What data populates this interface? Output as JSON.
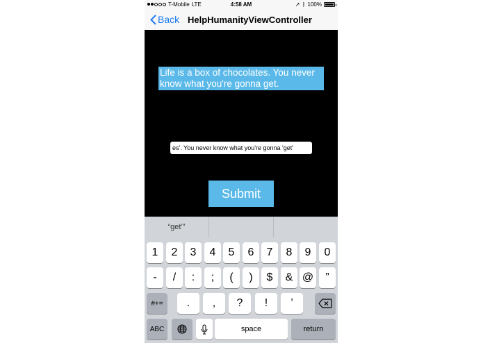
{
  "status_bar": {
    "carrier": "T-Mobile",
    "network": "LTE",
    "time": "4:58 AM",
    "battery": "100%"
  },
  "nav": {
    "back_label": "Back",
    "title": "HelpHumanityViewController"
  },
  "content": {
    "quote": "Life is a box of chocolates. You never know what you're gonna get.",
    "answer_value": "es'. You never know what you're gonna 'get'",
    "submit_label": "Submit"
  },
  "keyboard": {
    "predictions": [
      "“get’”",
      "",
      ""
    ],
    "row1": [
      "1",
      "2",
      "3",
      "4",
      "5",
      "6",
      "7",
      "8",
      "9",
      "0"
    ],
    "row2": [
      "-",
      "/",
      ":",
      ";",
      "(",
      ")",
      "$",
      "&",
      "@",
      "”"
    ],
    "row3_toggle": "#+=",
    "row3": [
      ".",
      ",",
      "?",
      "!",
      "’"
    ],
    "abc": "ABC",
    "space": "space",
    "return": "return"
  }
}
